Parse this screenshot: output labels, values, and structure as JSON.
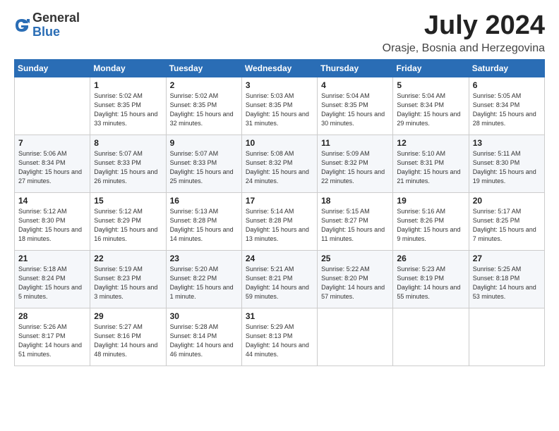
{
  "logo": {
    "general": "General",
    "blue": "Blue"
  },
  "header": {
    "month": "July 2024",
    "location": "Orasje, Bosnia and Herzegovina"
  },
  "weekdays": [
    "Sunday",
    "Monday",
    "Tuesday",
    "Wednesday",
    "Thursday",
    "Friday",
    "Saturday"
  ],
  "weeks": [
    [
      {
        "day": "",
        "sunrise": "",
        "sunset": "",
        "daylight": ""
      },
      {
        "day": "1",
        "sunrise": "Sunrise: 5:02 AM",
        "sunset": "Sunset: 8:35 PM",
        "daylight": "Daylight: 15 hours and 33 minutes."
      },
      {
        "day": "2",
        "sunrise": "Sunrise: 5:02 AM",
        "sunset": "Sunset: 8:35 PM",
        "daylight": "Daylight: 15 hours and 32 minutes."
      },
      {
        "day": "3",
        "sunrise": "Sunrise: 5:03 AM",
        "sunset": "Sunset: 8:35 PM",
        "daylight": "Daylight: 15 hours and 31 minutes."
      },
      {
        "day": "4",
        "sunrise": "Sunrise: 5:04 AM",
        "sunset": "Sunset: 8:35 PM",
        "daylight": "Daylight: 15 hours and 30 minutes."
      },
      {
        "day": "5",
        "sunrise": "Sunrise: 5:04 AM",
        "sunset": "Sunset: 8:34 PM",
        "daylight": "Daylight: 15 hours and 29 minutes."
      },
      {
        "day": "6",
        "sunrise": "Sunrise: 5:05 AM",
        "sunset": "Sunset: 8:34 PM",
        "daylight": "Daylight: 15 hours and 28 minutes."
      }
    ],
    [
      {
        "day": "7",
        "sunrise": "Sunrise: 5:06 AM",
        "sunset": "Sunset: 8:34 PM",
        "daylight": "Daylight: 15 hours and 27 minutes."
      },
      {
        "day": "8",
        "sunrise": "Sunrise: 5:07 AM",
        "sunset": "Sunset: 8:33 PM",
        "daylight": "Daylight: 15 hours and 26 minutes."
      },
      {
        "day": "9",
        "sunrise": "Sunrise: 5:07 AM",
        "sunset": "Sunset: 8:33 PM",
        "daylight": "Daylight: 15 hours and 25 minutes."
      },
      {
        "day": "10",
        "sunrise": "Sunrise: 5:08 AM",
        "sunset": "Sunset: 8:32 PM",
        "daylight": "Daylight: 15 hours and 24 minutes."
      },
      {
        "day": "11",
        "sunrise": "Sunrise: 5:09 AM",
        "sunset": "Sunset: 8:32 PM",
        "daylight": "Daylight: 15 hours and 22 minutes."
      },
      {
        "day": "12",
        "sunrise": "Sunrise: 5:10 AM",
        "sunset": "Sunset: 8:31 PM",
        "daylight": "Daylight: 15 hours and 21 minutes."
      },
      {
        "day": "13",
        "sunrise": "Sunrise: 5:11 AM",
        "sunset": "Sunset: 8:30 PM",
        "daylight": "Daylight: 15 hours and 19 minutes."
      }
    ],
    [
      {
        "day": "14",
        "sunrise": "Sunrise: 5:12 AM",
        "sunset": "Sunset: 8:30 PM",
        "daylight": "Daylight: 15 hours and 18 minutes."
      },
      {
        "day": "15",
        "sunrise": "Sunrise: 5:12 AM",
        "sunset": "Sunset: 8:29 PM",
        "daylight": "Daylight: 15 hours and 16 minutes."
      },
      {
        "day": "16",
        "sunrise": "Sunrise: 5:13 AM",
        "sunset": "Sunset: 8:28 PM",
        "daylight": "Daylight: 15 hours and 14 minutes."
      },
      {
        "day": "17",
        "sunrise": "Sunrise: 5:14 AM",
        "sunset": "Sunset: 8:28 PM",
        "daylight": "Daylight: 15 hours and 13 minutes."
      },
      {
        "day": "18",
        "sunrise": "Sunrise: 5:15 AM",
        "sunset": "Sunset: 8:27 PM",
        "daylight": "Daylight: 15 hours and 11 minutes."
      },
      {
        "day": "19",
        "sunrise": "Sunrise: 5:16 AM",
        "sunset": "Sunset: 8:26 PM",
        "daylight": "Daylight: 15 hours and 9 minutes."
      },
      {
        "day": "20",
        "sunrise": "Sunrise: 5:17 AM",
        "sunset": "Sunset: 8:25 PM",
        "daylight": "Daylight: 15 hours and 7 minutes."
      }
    ],
    [
      {
        "day": "21",
        "sunrise": "Sunrise: 5:18 AM",
        "sunset": "Sunset: 8:24 PM",
        "daylight": "Daylight: 15 hours and 5 minutes."
      },
      {
        "day": "22",
        "sunrise": "Sunrise: 5:19 AM",
        "sunset": "Sunset: 8:23 PM",
        "daylight": "Daylight: 15 hours and 3 minutes."
      },
      {
        "day": "23",
        "sunrise": "Sunrise: 5:20 AM",
        "sunset": "Sunset: 8:22 PM",
        "daylight": "Daylight: 15 hours and 1 minute."
      },
      {
        "day": "24",
        "sunrise": "Sunrise: 5:21 AM",
        "sunset": "Sunset: 8:21 PM",
        "daylight": "Daylight: 14 hours and 59 minutes."
      },
      {
        "day": "25",
        "sunrise": "Sunrise: 5:22 AM",
        "sunset": "Sunset: 8:20 PM",
        "daylight": "Daylight: 14 hours and 57 minutes."
      },
      {
        "day": "26",
        "sunrise": "Sunrise: 5:23 AM",
        "sunset": "Sunset: 8:19 PM",
        "daylight": "Daylight: 14 hours and 55 minutes."
      },
      {
        "day": "27",
        "sunrise": "Sunrise: 5:25 AM",
        "sunset": "Sunset: 8:18 PM",
        "daylight": "Daylight: 14 hours and 53 minutes."
      }
    ],
    [
      {
        "day": "28",
        "sunrise": "Sunrise: 5:26 AM",
        "sunset": "Sunset: 8:17 PM",
        "daylight": "Daylight: 14 hours and 51 minutes."
      },
      {
        "day": "29",
        "sunrise": "Sunrise: 5:27 AM",
        "sunset": "Sunset: 8:16 PM",
        "daylight": "Daylight: 14 hours and 48 minutes."
      },
      {
        "day": "30",
        "sunrise": "Sunrise: 5:28 AM",
        "sunset": "Sunset: 8:14 PM",
        "daylight": "Daylight: 14 hours and 46 minutes."
      },
      {
        "day": "31",
        "sunrise": "Sunrise: 5:29 AM",
        "sunset": "Sunset: 8:13 PM",
        "daylight": "Daylight: 14 hours and 44 minutes."
      },
      {
        "day": "",
        "sunrise": "",
        "sunset": "",
        "daylight": ""
      },
      {
        "day": "",
        "sunrise": "",
        "sunset": "",
        "daylight": ""
      },
      {
        "day": "",
        "sunrise": "",
        "sunset": "",
        "daylight": ""
      }
    ]
  ]
}
